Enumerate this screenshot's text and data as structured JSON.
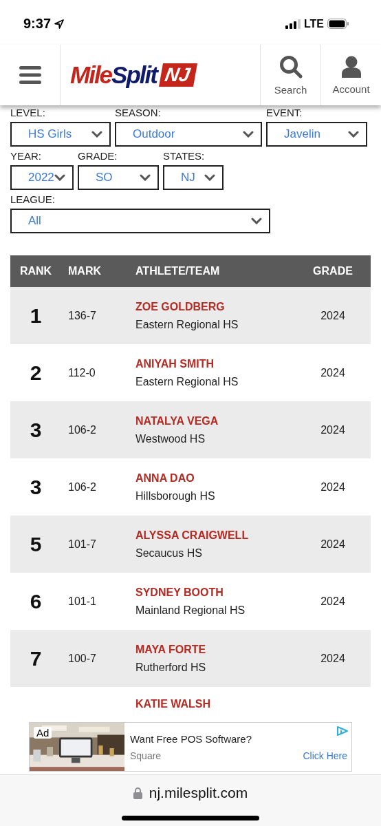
{
  "status_bar": {
    "time": "9:37",
    "network": "LTE"
  },
  "header": {
    "logo": {
      "parts": [
        {
          "text": "Mile",
          "color": "#c4261c"
        },
        {
          "text": "Split",
          "color": "#101a6b"
        }
      ],
      "badge": "NJ"
    },
    "nav": [
      {
        "kind": "search",
        "label": "Search"
      },
      {
        "kind": "account",
        "label": "Account"
      }
    ]
  },
  "filters": [
    [
      {
        "label": "LEVEL:",
        "value": "HS Girls"
      },
      {
        "label": "SEASON:",
        "value": "Outdoor"
      },
      {
        "label": "EVENT:",
        "value": "Javelin"
      }
    ],
    [
      {
        "label": "YEAR:",
        "value": "2022"
      },
      {
        "label": "GRADE:",
        "value": "SO"
      },
      {
        "label": "STATES:",
        "value": "NJ"
      }
    ],
    [
      {
        "label": "LEAGUE:",
        "value": "All"
      }
    ]
  ],
  "table": {
    "columns": [
      "RANK",
      "MARK",
      "ATHLETE/TEAM",
      "GRADE"
    ],
    "rows": [
      {
        "rank": "1",
        "mark": "136-7",
        "athlete": "ZOE GOLDBERG",
        "team": "Eastern Regional HS",
        "grade": "2024"
      },
      {
        "rank": "2",
        "mark": "112-0",
        "athlete": "ANIYAH SMITH",
        "team": "Eastern Regional HS",
        "grade": "2024"
      },
      {
        "rank": "3",
        "mark": "106-2",
        "athlete": "NATALYA VEGA",
        "team": "Westwood HS",
        "grade": "2024"
      },
      {
        "rank": "3",
        "mark": "106-2",
        "athlete": "ANNA DAO",
        "team": "Hillsborough HS",
        "grade": "2024"
      },
      {
        "rank": "5",
        "mark": "101-7",
        "athlete": "ALYSSA CRAIGWELL",
        "team": "Secaucus HS",
        "grade": "2024"
      },
      {
        "rank": "6",
        "mark": "101-1",
        "athlete": "SYDNEY BOOTH",
        "team": "Mainland Regional HS",
        "grade": "2024"
      },
      {
        "rank": "7",
        "mark": "100-7",
        "athlete": "MAYA FORTE",
        "team": "Rutherford HS",
        "grade": "2024"
      },
      {
        "athlete": "KATIE WALSH"
      }
    ]
  },
  "ad": {
    "badge": "Ad",
    "title": "Want Free POS Software?",
    "advertiser": "Square",
    "cta": "Click Here"
  },
  "browser_bar": {
    "url": "nj.milesplit.com"
  }
}
